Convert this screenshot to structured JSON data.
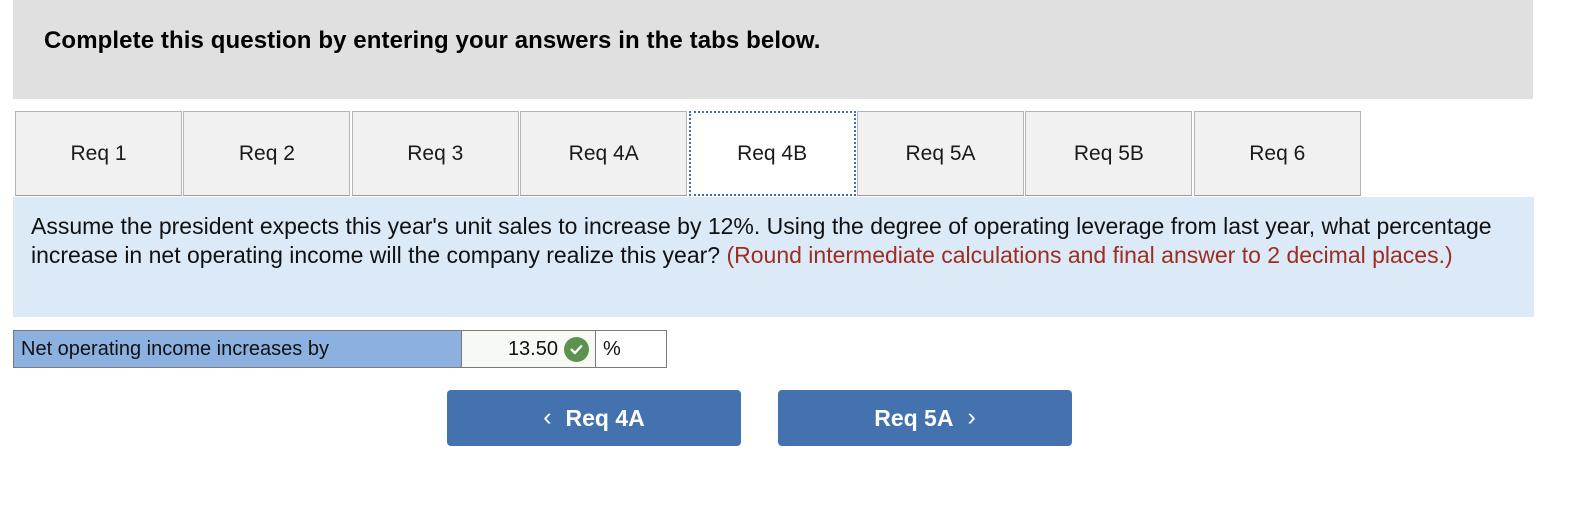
{
  "header": {
    "title": "Complete this question by entering your answers in the tabs below.",
    "background_color": "#e0e0e0"
  },
  "tabs": {
    "active_index": 4,
    "items": [
      {
        "label": "Req 1"
      },
      {
        "label": "Req 2"
      },
      {
        "label": "Req 3"
      },
      {
        "label": "Req 4A"
      },
      {
        "label": "Req 4B"
      },
      {
        "label": "Req 5A"
      },
      {
        "label": "Req 5B"
      },
      {
        "label": "Req 6"
      }
    ],
    "active_border_color": "#3f6fb5"
  },
  "question": {
    "body": "Assume the president expects this year's unit sales to increase by 12%. Using the degree of operating leverage from last year, what percentage increase in net operating income will the company realize this year? ",
    "hint": "(Round intermediate calculations and final answer to 2 decimal places.)",
    "background_color": "#dce9f7",
    "hint_color": "#9c2d20"
  },
  "answer": {
    "label": "Net operating income increases by",
    "value": "13.50",
    "unit": "%",
    "status_icon": "check-circle-icon",
    "status_color": "#5c9150",
    "label_background": "#8cb1e0",
    "value_background": "#f7faf4"
  },
  "navigation": {
    "prev_label": "Req 4A",
    "prev_icon": "chevron-left-icon",
    "next_label": "Req 5A",
    "next_icon": "chevron-right-icon",
    "button_color": "#4472ae"
  }
}
